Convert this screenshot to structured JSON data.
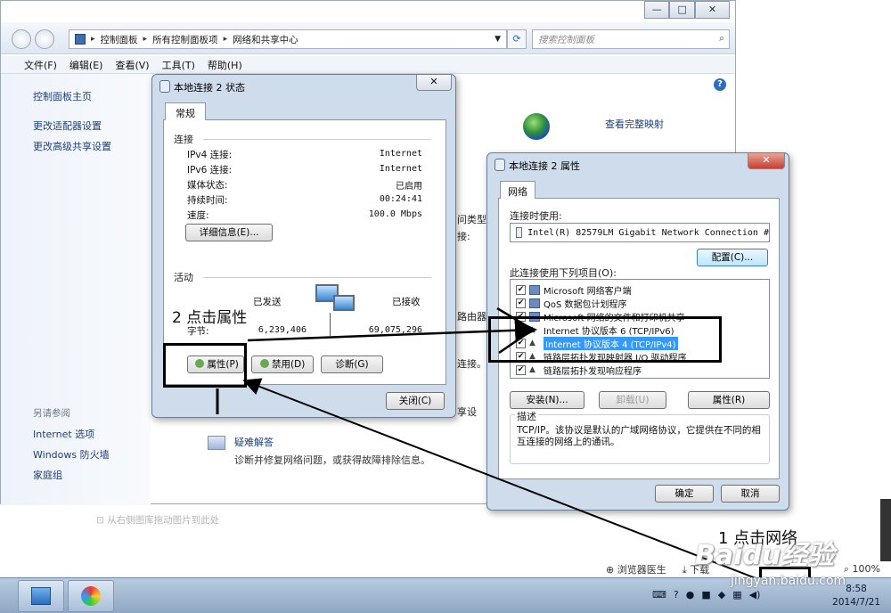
{
  "explorer": {
    "breadcrumb": [
      "控制面板",
      "所有控制面板项",
      "网络和共享中心"
    ],
    "search_placeholder": "搜索控制面板",
    "menu": [
      "文件(F)",
      "编辑(E)",
      "查看(V)",
      "工具(T)",
      "帮助(H)"
    ],
    "sidebar_top": [
      "控制面板主页",
      "更改适配器设置",
      "更改高级共享设置"
    ],
    "see_also_heading": "另请参阅",
    "see_also": [
      "Internet 选项",
      "Windows 防火墙",
      "家庭组"
    ],
    "view_full_map": "查看完整映射",
    "peek_texts": [
      "问类型:",
      "接:",
      "路由器",
      "连接。",
      "享设"
    ],
    "troubleshoot_title": "疑难解答",
    "troubleshoot_desc": "诊断并修复网络问题，或获得故障排除信息。"
  },
  "status_dialog": {
    "title": "本地连接 2 状态",
    "tab": "常规",
    "connection_group": "连接",
    "rows": [
      {
        "key": "IPv4 连接:",
        "value": "Internet"
      },
      {
        "key": "IPv6 连接:",
        "value": "Internet"
      },
      {
        "key": "媒体状态:",
        "value": "已启用"
      },
      {
        "key": "持续时间:",
        "value": "00:24:41"
      },
      {
        "key": "速度:",
        "value": "100.0 Mbps"
      }
    ],
    "details_button": "详细信息(E)...",
    "activity_group": "活动",
    "sent_label": "已发送",
    "received_label": "已接收",
    "bytes_label": "字节:",
    "bytes_sent": "6,239,406",
    "bytes_received": "69,075,296",
    "properties_button": "属性(P)",
    "disable_button": "禁用(D)",
    "diagnose_button": "诊断(G)",
    "close_button": "关闭(C)"
  },
  "props_dialog": {
    "title": "本地连接 2 属性",
    "tab": "网络",
    "connect_using_label": "连接时使用:",
    "adapter": "Intel(R) 82579LM Gigabit Network Connection #",
    "configure_button": "配置(C)...",
    "items_label": "此连接使用下列项目(O):",
    "items": [
      {
        "label": "Microsoft 网络客户端",
        "checked": true,
        "selected": false
      },
      {
        "label": "QoS 数据包计划程序",
        "checked": true,
        "selected": false
      },
      {
        "label": "Microsoft 网络的文件和打印机共享",
        "checked": true,
        "selected": false
      },
      {
        "label": "Internet 协议版本 6 (TCP/IPv6)",
        "checked": true,
        "selected": false
      },
      {
        "label": "Internet 协议版本 4 (TCP/IPv4)",
        "checked": true,
        "selected": true
      },
      {
        "label": "链路层拓扑发现映射器 I/O 驱动程序",
        "checked": true,
        "selected": false
      },
      {
        "label": "链路层拓扑发现响应程序",
        "checked": true,
        "selected": false
      }
    ],
    "install_button": "安装(N)...",
    "uninstall_button": "卸载(U)",
    "properties_button": "属性(R)",
    "description_heading": "描述",
    "description": "TCP/IP。该协议是默认的广域网络协议，它提供在不同的相互连接的网络上的通讯。",
    "ok_button": "确定",
    "cancel_button": "取消"
  },
  "annotations": {
    "step2": "2 点击属性",
    "step1": "1 点击网络"
  },
  "background": {
    "drag_hint": "从右侧图库拖动图片到此处",
    "browser_doctor": "浏览器医生",
    "download": "下载",
    "zoom": "100%"
  },
  "taskbar": {
    "time": "8:58",
    "date": "2014/7/21"
  },
  "watermark": {
    "brand": "Baidu经验",
    "url": "jingyan.baidu.com"
  }
}
